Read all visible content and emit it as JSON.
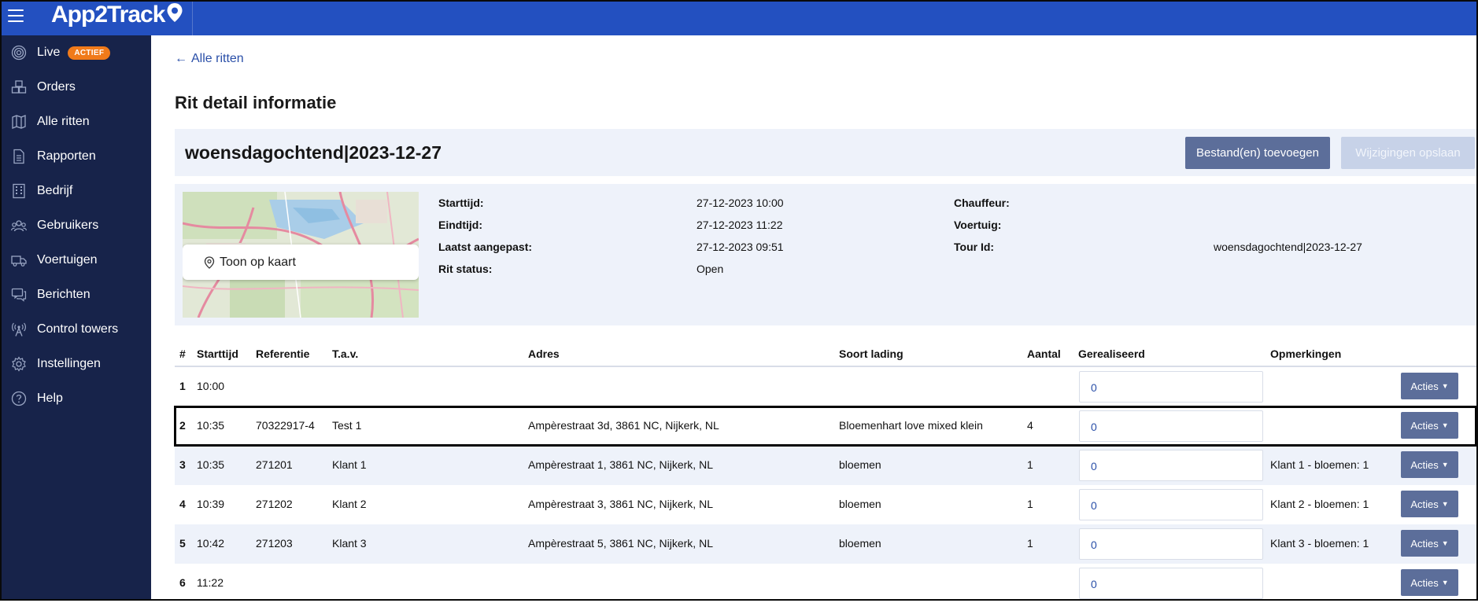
{
  "app": {
    "name": "App2Track"
  },
  "sidebar": {
    "items": [
      {
        "label": "Live",
        "icon": "live-target-icon",
        "badge": "ACTIEF"
      },
      {
        "label": "Orders",
        "icon": "boxes-icon"
      },
      {
        "label": "Alle ritten",
        "icon": "map-icon"
      },
      {
        "label": "Rapporten",
        "icon": "document-icon"
      },
      {
        "label": "Bedrijf",
        "icon": "building-icon"
      },
      {
        "label": "Gebruikers",
        "icon": "users-icon"
      },
      {
        "label": "Voertuigen",
        "icon": "truck-icon"
      },
      {
        "label": "Berichten",
        "icon": "messages-icon"
      },
      {
        "label": "Control towers",
        "icon": "tower-icon"
      },
      {
        "label": "Instellingen",
        "icon": "gear-icon"
      },
      {
        "label": "Help",
        "icon": "help-icon"
      }
    ]
  },
  "main": {
    "back_label": "Alle ritten",
    "page_title": "Rit detail informatie",
    "route_name": "woensdagochtend|2023-12-27",
    "buttons": {
      "add_files": "Bestand(en) toevoegen",
      "save": "Wijzigingen opslaan"
    },
    "map_button": "Toon op kaart",
    "info": {
      "start_label": "Starttijd:",
      "start_value": "27-12-2023 10:00",
      "end_label": "Eindtijd:",
      "end_value": "27-12-2023 11:22",
      "modified_label": "Laatst aangepast:",
      "modified_value": "27-12-2023 09:51",
      "status_label": "Rit status:",
      "status_value": "Open",
      "driver_label": "Chauffeur:",
      "driver_value": "",
      "vehicle_label": "Voertuig:",
      "vehicle_value": "",
      "tour_label": "Tour Id:",
      "tour_value": "woensdagochtend|2023-12-27"
    }
  },
  "table": {
    "headers": [
      "#",
      "Starttijd",
      "Referentie",
      "T.a.v.",
      "Adres",
      "Soort lading",
      "Aantal",
      "Gerealiseerd",
      "Opmerkingen"
    ],
    "action_label": "Acties",
    "rows": [
      {
        "num": "1",
        "time": "10:00",
        "ref": "",
        "tav": "",
        "address": "",
        "cargo": "",
        "count": "",
        "realized": "0",
        "remarks": ""
      },
      {
        "num": "2",
        "time": "10:35",
        "ref": "70322917-4",
        "tav": "Test 1",
        "address": "Ampèrestraat 3d, 3861 NC, Nijkerk, NL",
        "cargo": "Bloemenhart love mixed klein",
        "count": "4",
        "realized": "0",
        "remarks": ""
      },
      {
        "num": "3",
        "time": "10:35",
        "ref": "271201",
        "tav": "Klant 1",
        "address": "Ampèrestraat 1, 3861 NC, Nijkerk, NL",
        "cargo": "bloemen",
        "count": "1",
        "realized": "0",
        "remarks": "Klant 1 - bloemen: 1"
      },
      {
        "num": "4",
        "time": "10:39",
        "ref": "271202",
        "tav": "Klant 2",
        "address": "Ampèrestraat 3, 3861 NC, Nijkerk, NL",
        "cargo": "bloemen",
        "count": "1",
        "realized": "0",
        "remarks": "Klant 2 - bloemen: 1"
      },
      {
        "num": "5",
        "time": "10:42",
        "ref": "271203",
        "tav": "Klant 3",
        "address": "Ampèrestraat 5, 3861 NC, Nijkerk, NL",
        "cargo": "bloemen",
        "count": "1",
        "realized": "0",
        "remarks": "Klant 3 - bloemen: 1"
      },
      {
        "num": "6",
        "time": "11:22",
        "ref": "",
        "tav": "",
        "address": "",
        "cargo": "",
        "count": "",
        "realized": "0",
        "remarks": ""
      }
    ]
  },
  "colors": {
    "topbar": "#2350c0",
    "sidebar": "#17234a",
    "badge": "#f07a1a",
    "panel": "#eef2fa",
    "button": "#5c6e9a",
    "link": "#2a4fa8"
  }
}
